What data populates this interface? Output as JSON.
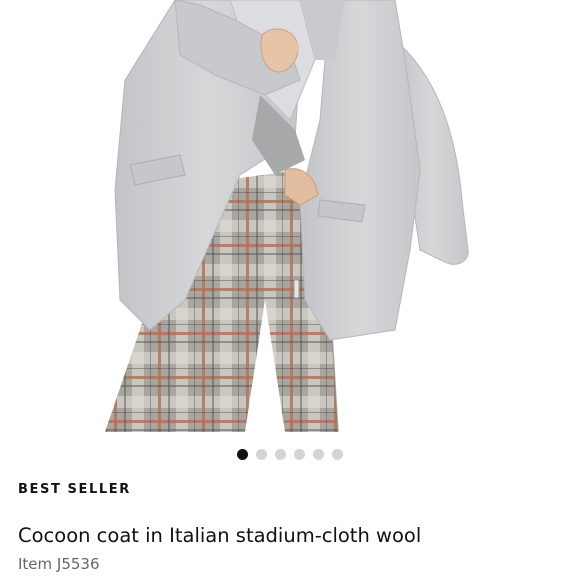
{
  "product": {
    "badge": "BEST SELLER",
    "title": "Cocoon coat in Italian stadium-cloth wool",
    "item_number": "Item J5536"
  },
  "carousel": {
    "total": 6,
    "active_index": 0
  },
  "colors": {
    "coat": "#cfd0d2",
    "plaid_base": "#9a9893",
    "plaid_accent": "#b0735a",
    "dot_active": "#111111",
    "dot_inactive": "#d4d4d4"
  }
}
